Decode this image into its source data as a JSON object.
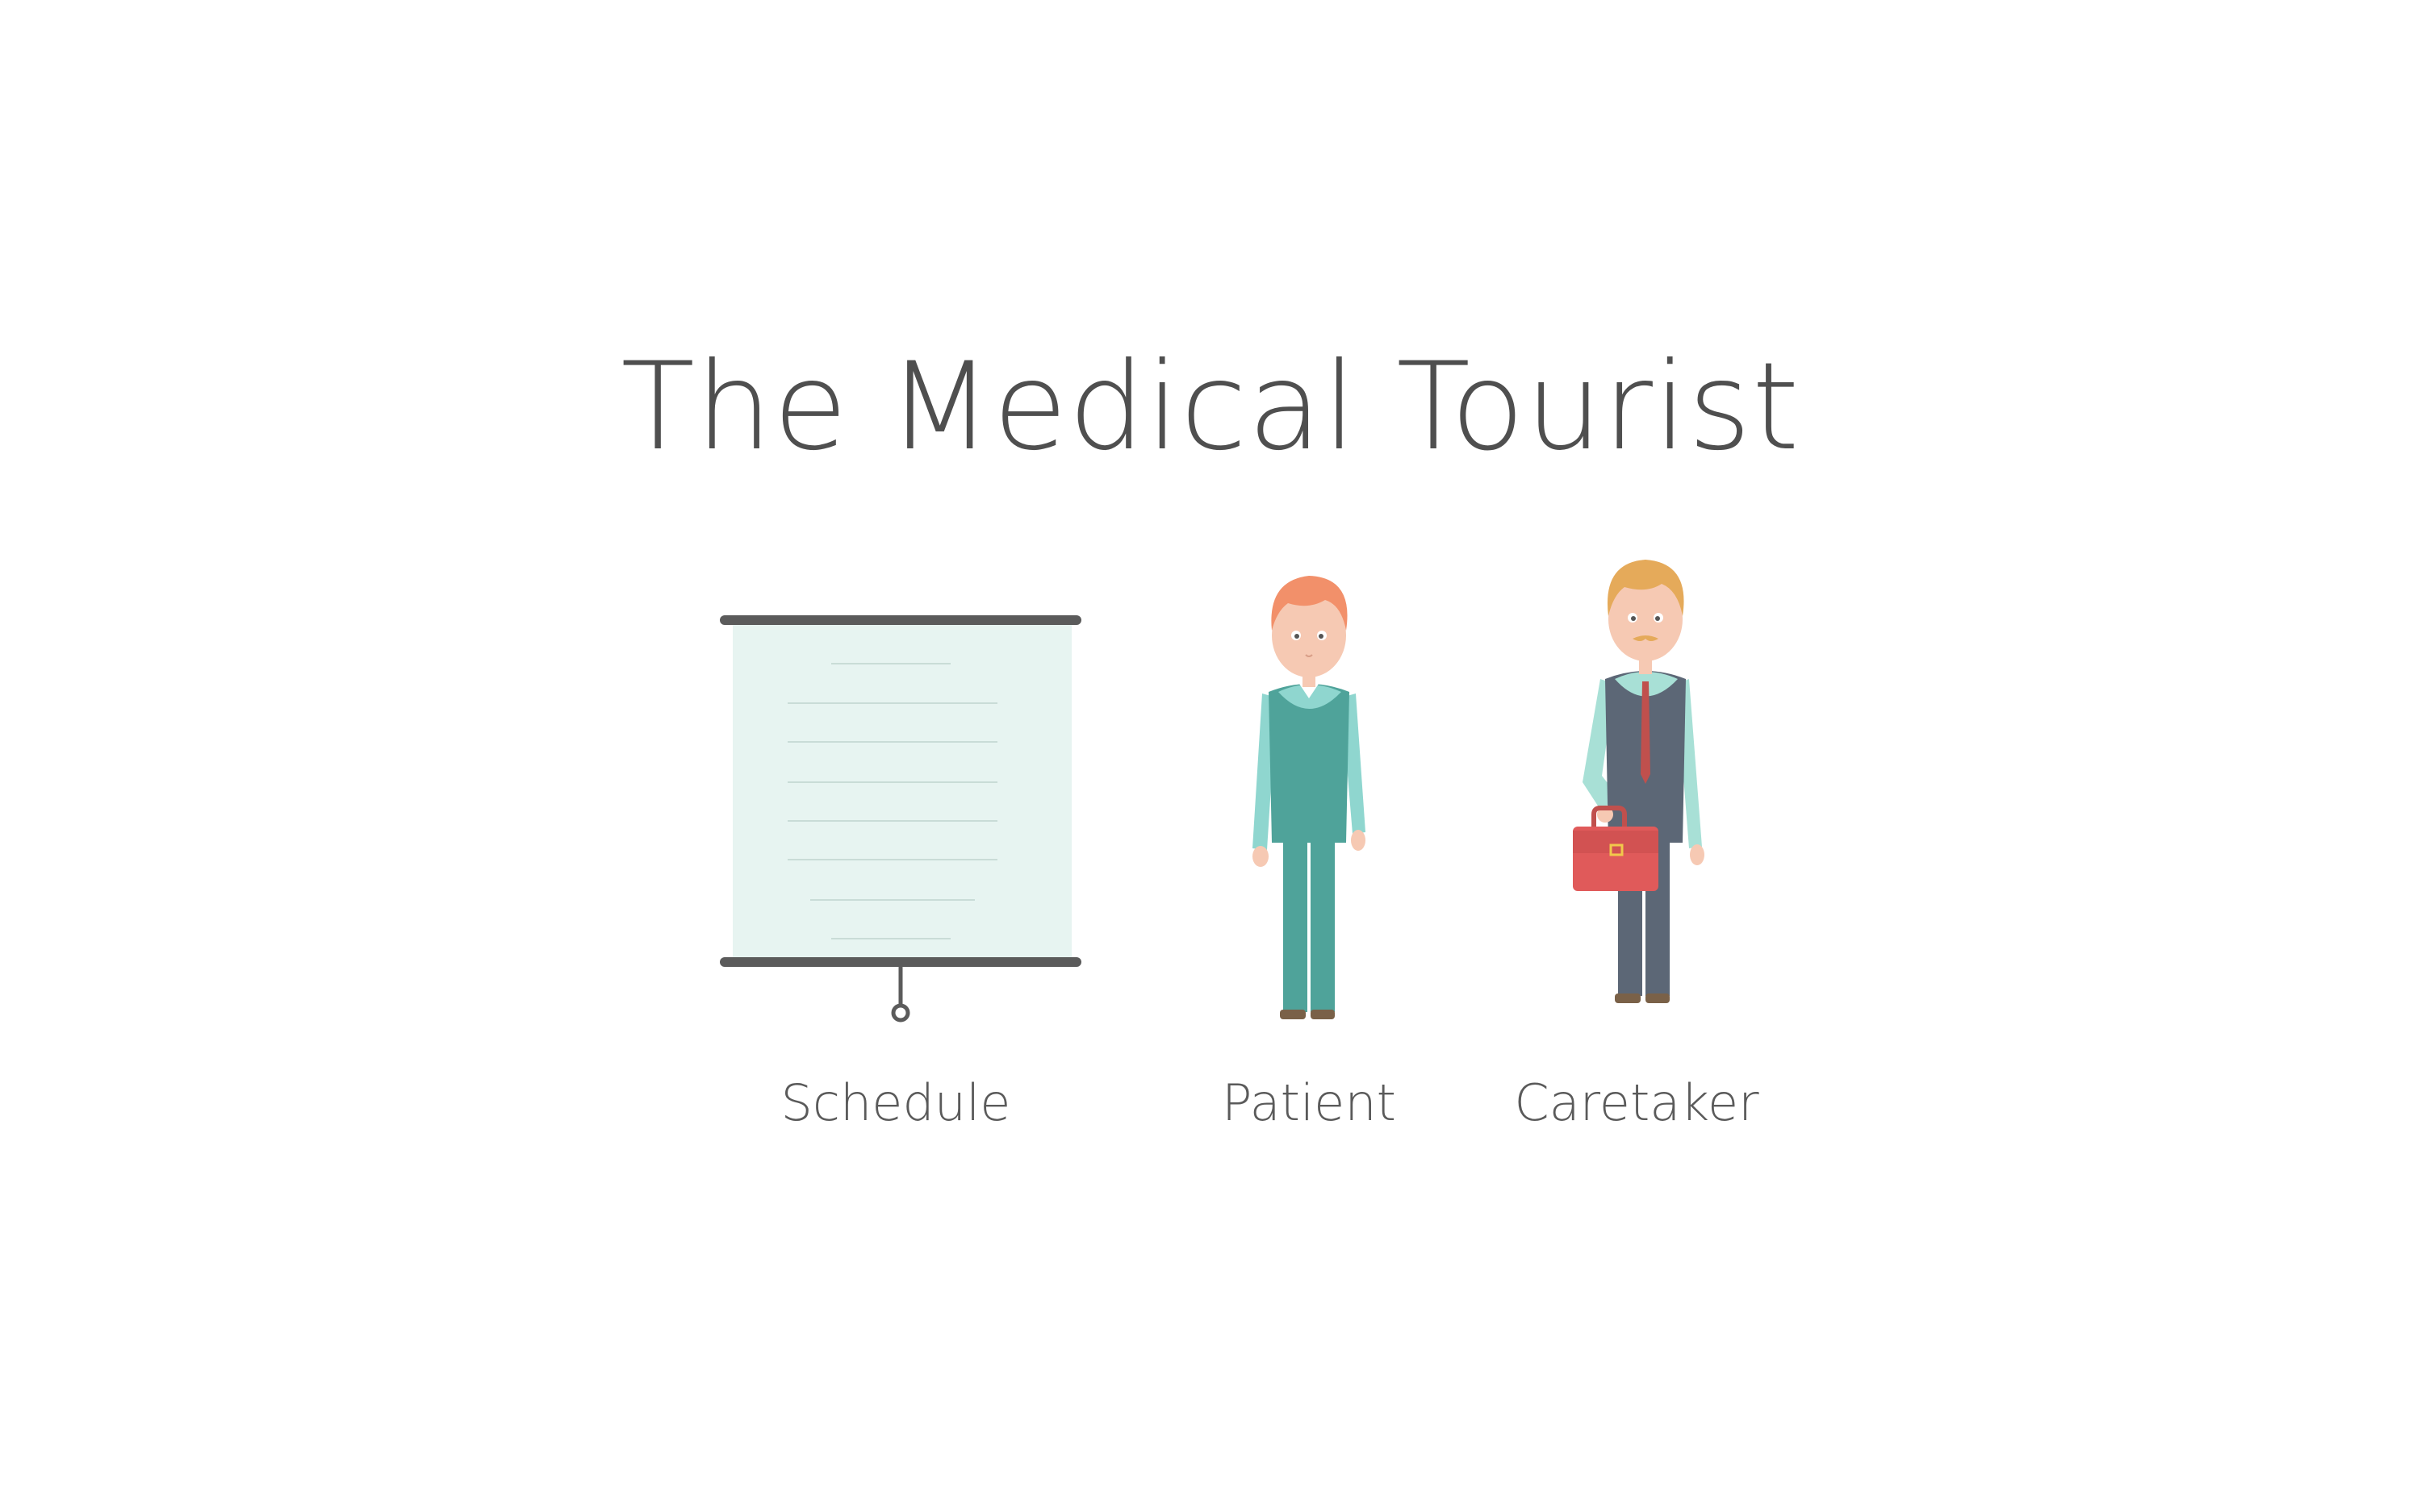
{
  "title": "The Medical Tourist",
  "items": [
    {
      "label": "Schedule",
      "icon": "projector-screen-icon"
    },
    {
      "label": "Patient",
      "icon": "patient-figure-icon"
    },
    {
      "label": "Caretaker",
      "icon": "caretaker-figure-icon"
    }
  ],
  "colors": {
    "text": "#555555",
    "screen_fill": "#e7f4f1",
    "screen_frame": "#5b5b5b",
    "teal": "#4fa39a",
    "light_teal": "#8fd6cf",
    "skin": "#f6c9b3",
    "ginger_hair": "#f2906a",
    "blond_hair": "#e5aa5a",
    "vest_gray": "#5c6776",
    "tie_red": "#c0504d",
    "briefcase_red": "#e05a5a"
  }
}
